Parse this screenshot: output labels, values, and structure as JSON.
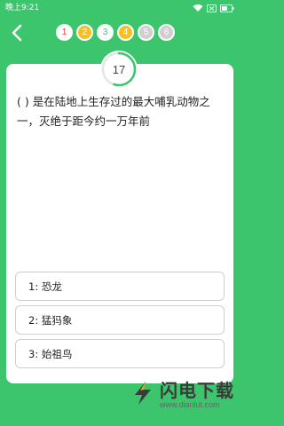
{
  "status_bar": {
    "time": "晚上9:21",
    "icons": [
      "wifi-icon",
      "sim-icon",
      "battery-icon"
    ]
  },
  "nav": {
    "back_icon": "chevron-left-icon"
  },
  "progress": {
    "dots": [
      {
        "label": "1",
        "state": "correct-red-outline"
      },
      {
        "label": "2",
        "state": "answered-yellow"
      },
      {
        "label": "3",
        "state": "current-green"
      },
      {
        "label": "4",
        "state": "answered-yellow"
      },
      {
        "label": "5",
        "state": "pending-grey"
      },
      {
        "label": "6",
        "state": "pending-grey"
      }
    ]
  },
  "timer": {
    "value": "17",
    "fraction_remaining": 0.55,
    "accent_color": "#3cc56c"
  },
  "question": {
    "text": "( ) 是在陆地上生存过的最大哺乳动物之一，灭绝于距今约一万年前"
  },
  "options": [
    {
      "label": "1: 恐龙"
    },
    {
      "label": "2: 猛犸象"
    },
    {
      "label": "3: 始祖鸟"
    }
  ],
  "watermark": {
    "title": "闪电下载",
    "url": "www.dianlut.com",
    "icon": "lightning-logo-icon"
  },
  "colors": {
    "background": "#3cc56c",
    "card": "#ffffff",
    "yellow": "#f6c023",
    "red": "#e84a3d",
    "grey": "#cfcfcf"
  }
}
